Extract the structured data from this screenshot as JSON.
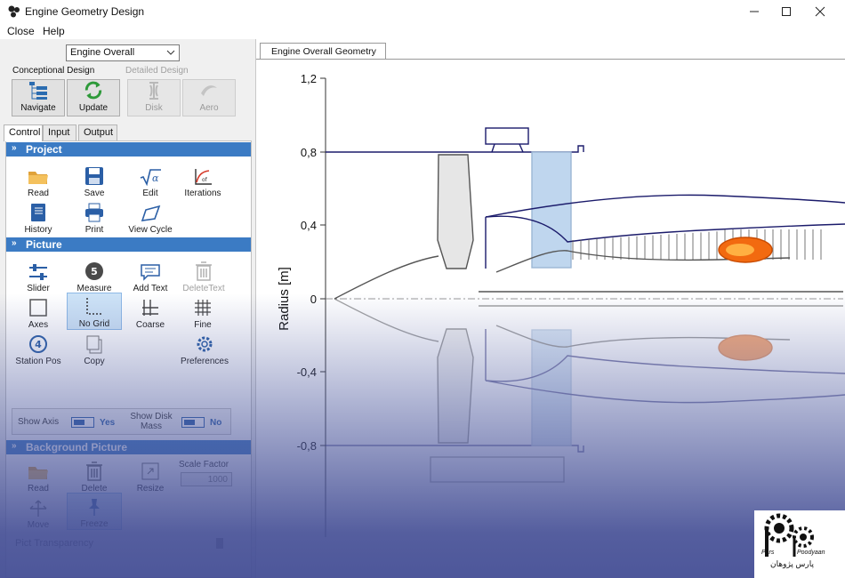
{
  "window": {
    "title": "Engine Geometry Design",
    "controls": {
      "minimize": "minimize-icon",
      "maximize": "maximize-icon",
      "close": "close-icon"
    }
  },
  "menu": [
    "Close",
    "Help"
  ],
  "left_panel": {
    "view_select": {
      "selected": "Engine Overall"
    },
    "groups": {
      "conceptional": "Conceptional Design",
      "detailed": "Detailed Design"
    },
    "design_buttons": [
      {
        "label": "Navigate",
        "icon": "navigate-icon",
        "enabled": true
      },
      {
        "label": "Update",
        "icon": "refresh-icon",
        "enabled": true
      },
      {
        "label": "Disk",
        "icon": "disk-icon",
        "enabled": false
      },
      {
        "label": "Aero",
        "icon": "blade-icon",
        "enabled": false
      }
    ],
    "tabs": [
      {
        "label": "Control",
        "active": true
      },
      {
        "label": "Input",
        "active": false
      },
      {
        "label": "Output",
        "active": false
      }
    ],
    "project": {
      "title": "Project",
      "tools": [
        {
          "label": "Read",
          "icon": "folder-icon"
        },
        {
          "label": "Save",
          "icon": "save-icon"
        },
        {
          "label": "Edit",
          "icon": "sqrt-icon"
        },
        {
          "label": "Iterations",
          "icon": "iterations-icon"
        },
        {
          "label": "History",
          "icon": "book-icon"
        },
        {
          "label": "Print",
          "icon": "printer-icon"
        },
        {
          "label": "View Cycle",
          "icon": "cycle-icon"
        }
      ]
    },
    "picture": {
      "title": "Picture",
      "tools": [
        {
          "label": "Slider",
          "icon": "slider-icon",
          "enabled": true
        },
        {
          "label": "Measure",
          "icon": "measure-icon",
          "enabled": true,
          "badge": "5"
        },
        {
          "label": "Add Text",
          "icon": "comment-icon",
          "enabled": true
        },
        {
          "label": "DeleteText",
          "icon": "trash-icon",
          "enabled": false
        },
        {
          "label": "Axes",
          "icon": "axes-icon",
          "enabled": true
        },
        {
          "label": "No Grid",
          "icon": "no-grid-icon",
          "enabled": true,
          "selected": true
        },
        {
          "label": "Coarse",
          "icon": "coarse-grid-icon",
          "enabled": true
        },
        {
          "label": "Fine",
          "icon": "fine-grid-icon",
          "enabled": true
        },
        {
          "label": "Station Pos",
          "icon": "station-icon",
          "enabled": true,
          "badge": "4"
        },
        {
          "label": "Copy",
          "icon": "copy-icon",
          "enabled": true
        },
        {
          "label": "Preferences",
          "icon": "gear-icon",
          "enabled": true
        }
      ],
      "toggles": [
        {
          "label": "Show Axis",
          "value": "Yes"
        },
        {
          "label": "Show Disk Mass",
          "value": "No"
        }
      ]
    },
    "background": {
      "title": "Background Picture",
      "tools": [
        {
          "label": "Read",
          "icon": "folder-icon"
        },
        {
          "label": "Delete",
          "icon": "trash-icon"
        },
        {
          "label": "Resize",
          "icon": "resize-icon"
        },
        {
          "label": "Move",
          "icon": "move-icon"
        },
        {
          "label": "Freeze",
          "icon": "pin-icon"
        }
      ],
      "scale_factor": {
        "label": "Scale Factor",
        "value": "1000"
      },
      "transparency": {
        "label": "Pict Transparency"
      }
    }
  },
  "document": {
    "tab": "Engine Overall Geometry",
    "plot": {
      "y_label": "Radius [m]",
      "y_ticks": [
        "1,2",
        "0,8",
        "0,4",
        "0",
        "-0,4",
        "-0,8"
      ]
    }
  },
  "logo": {
    "line1": "Pars",
    "line2": "Poodyaan",
    "line3": "پارس پژوهان"
  },
  "colors": {
    "accent": "#3b7bc4",
    "engine_line": "#1b1b6b",
    "duct": "#bfd6ee",
    "flame": "#f26a10"
  }
}
